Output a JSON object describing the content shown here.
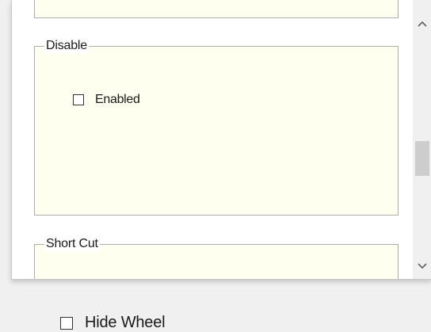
{
  "panel": {
    "groups": [
      {
        "legend": "Disable",
        "options": [
          {
            "label": "Enabled",
            "checked": false
          }
        ]
      },
      {
        "legend": "Short Cut",
        "options": []
      }
    ],
    "scrollbar": {
      "up_icon": "chevron-up-icon",
      "down_icon": "chevron-down-icon"
    }
  },
  "outer_options": [
    {
      "label": "Hide Wheel",
      "checked": false
    }
  ],
  "colors": {
    "group_background": "#fffff0",
    "group_border": "#adadad",
    "window_background": "#f0f0f0"
  }
}
